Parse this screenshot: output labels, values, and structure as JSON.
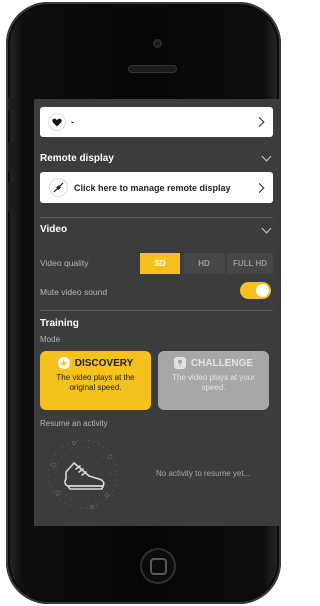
{
  "top_card": {
    "label": "-",
    "icon": "heart-icon"
  },
  "remote_display": {
    "title": "Remote display",
    "manage_label": "Click here to manage remote display",
    "icon": "connection-icon"
  },
  "video": {
    "title": "Video",
    "quality_label": "Video quality",
    "quality_options": [
      "SD",
      "HD",
      "FULL HD"
    ],
    "quality_selected": "SD",
    "mute_label": "Mute video sound",
    "mute_enabled": true
  },
  "training": {
    "title": "Training",
    "mode_label": "Mode",
    "modes": [
      {
        "name": "DISCOVERY",
        "description": "The video plays at the original speed.",
        "selected": true,
        "icon": "star-icon"
      },
      {
        "name": "CHALLENGE",
        "description": "The video plays at your speed.",
        "selected": false,
        "icon": "trophy-icon"
      }
    ],
    "resume_label": "Resume an activity",
    "no_activity_text": "No activity to resume yet...",
    "illustration_icon": "running-shoe-icon"
  },
  "colors": {
    "accent": "#f5c21b",
    "screen_bg": "#3b3c3d",
    "card_bg": "#ffffff",
    "inactive_card": "#a7a7a7"
  }
}
